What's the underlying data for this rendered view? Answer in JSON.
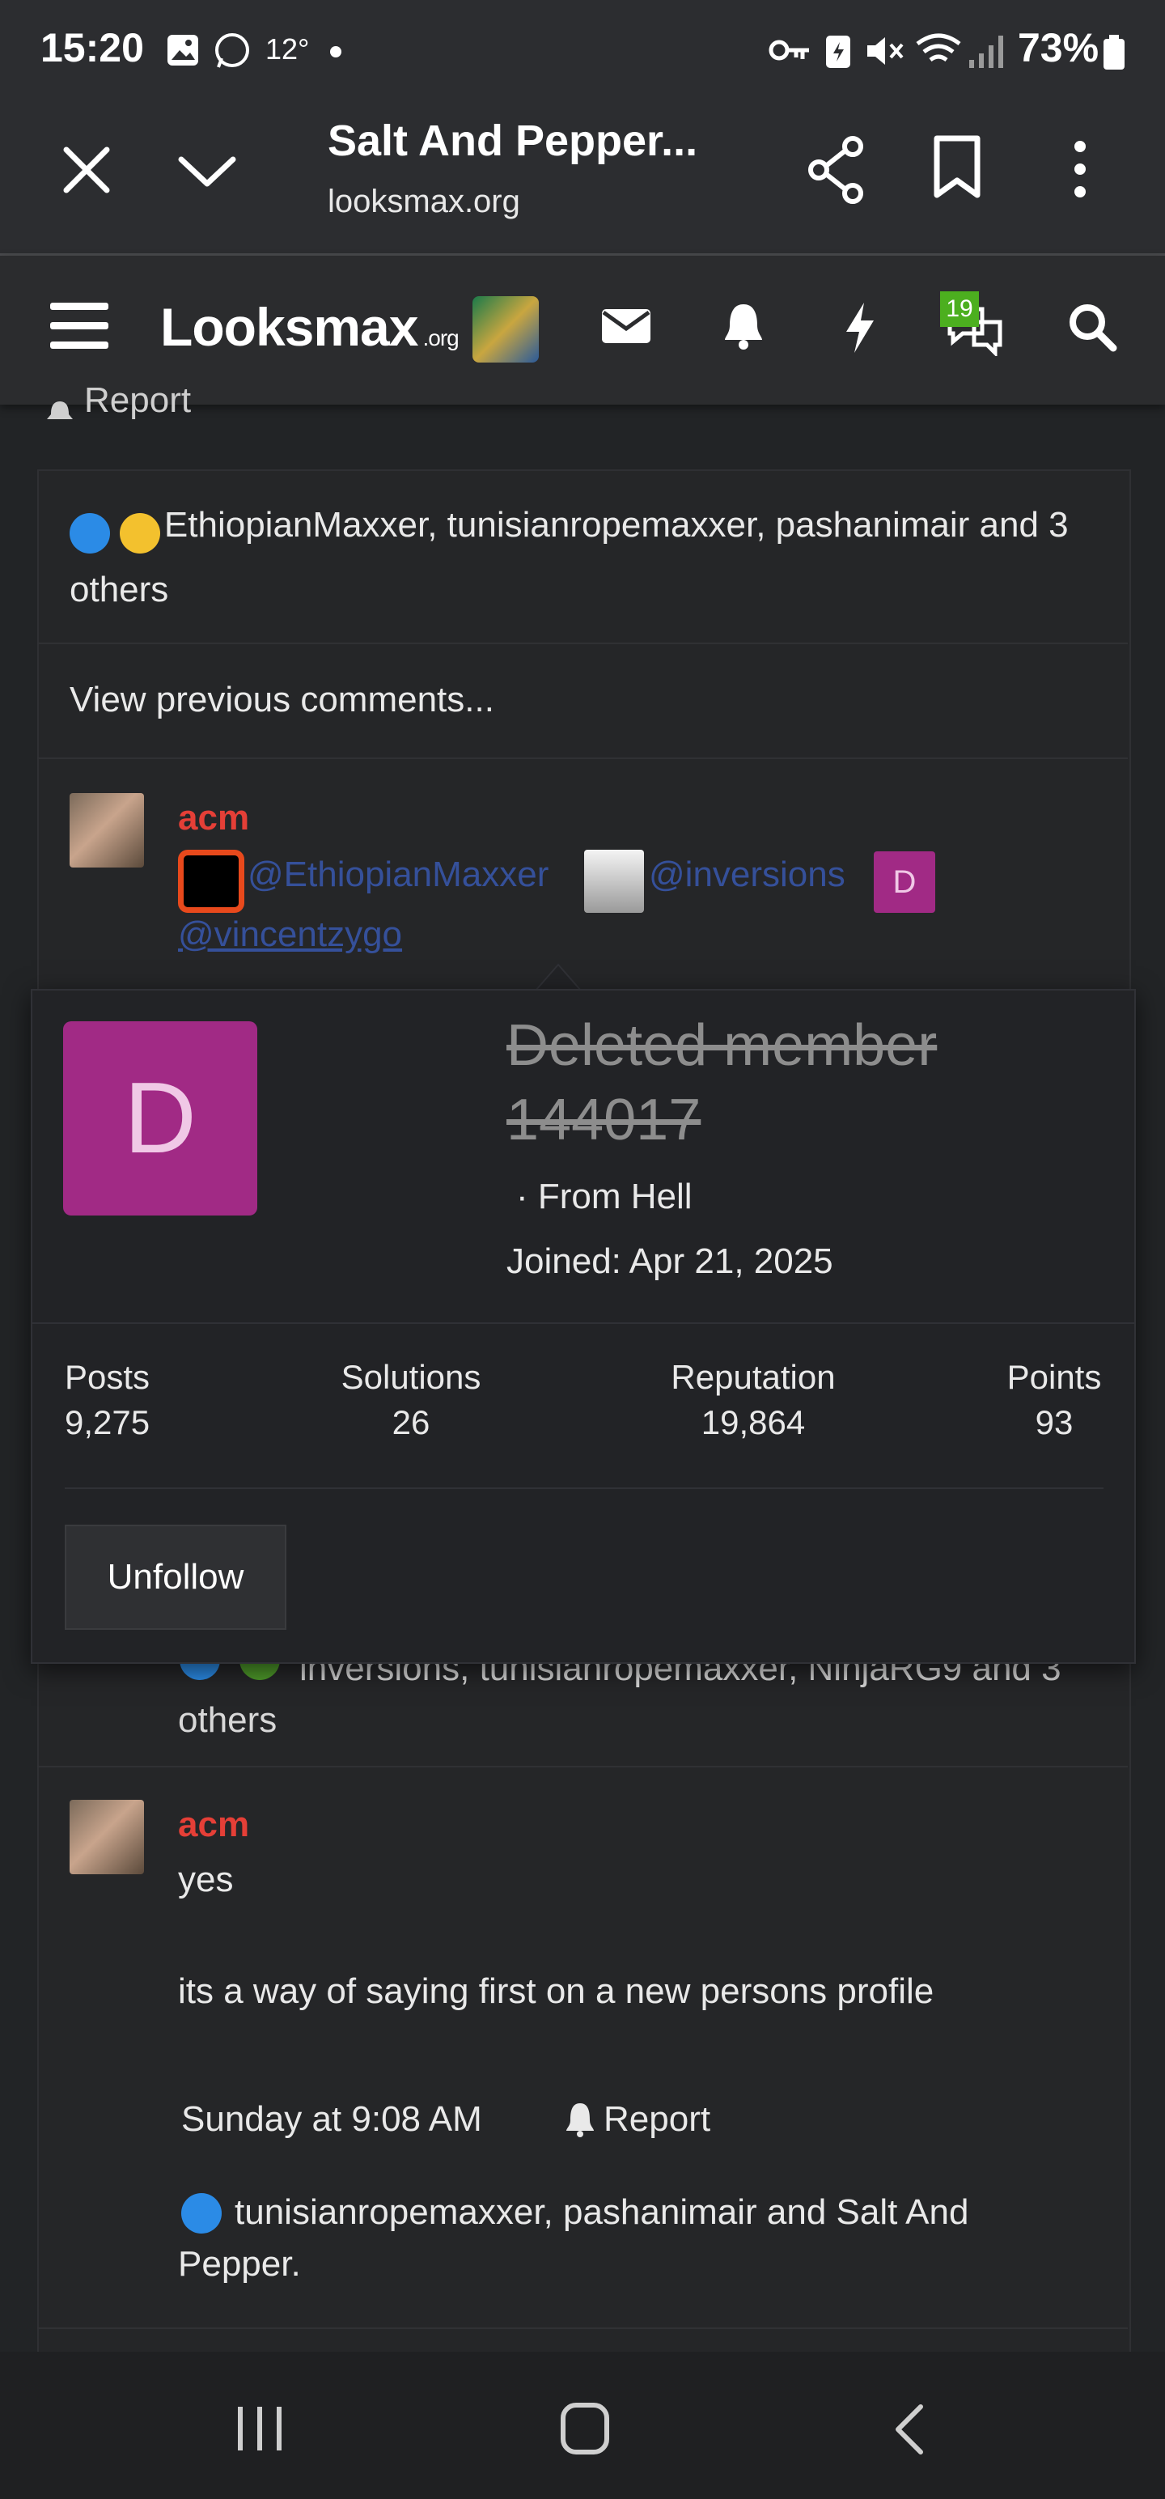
{
  "status_bar": {
    "time": "15:20",
    "temperature": "12°",
    "battery": "73%"
  },
  "browser": {
    "page_title": "Salt And Pepper...",
    "url": "looksmax.org"
  },
  "site": {
    "logo": "Looksmax",
    "logo_suffix": ".org",
    "messages_badge": "19"
  },
  "peek_text": "Report",
  "top_reactions": {
    "text": "EthiopianMaxxer, tunisianropemaxxer, pashanimair and 3 others"
  },
  "view_previous": "View previous comments...",
  "comment1": {
    "author": "acm",
    "mentions": [
      "@EthiopianMaxxer",
      "@inversions",
      "@vincentzygo"
    ],
    "avatar_letter": "D",
    "reactions_text": "inversions, tunisianropemaxxer, NinjaRG9 and 3 others"
  },
  "popup": {
    "avatar_letter": "D",
    "name": "Deleted member 144017",
    "location": "· From Hell",
    "joined": "Joined: Apr 21, 2025",
    "stats": [
      {
        "label": "Posts",
        "value": "9,275"
      },
      {
        "label": "Solutions",
        "value": "26"
      },
      {
        "label": "Reputation",
        "value": "19,864"
      },
      {
        "label": "Points",
        "value": "93"
      }
    ],
    "unfollow": "Unfollow"
  },
  "comment2": {
    "author": "acm",
    "line1": "yes",
    "line2": "its a way of saying first on a new persons profile",
    "timestamp": "Sunday at 9:08 AM",
    "report": "Report",
    "reactions_text": "tunisianropemaxxer, pashanimair and Salt And Pepper."
  },
  "icons": [
    "close-icon",
    "chevron-down-icon",
    "share-icon",
    "bookmark-icon",
    "more-icon",
    "menu-icon",
    "mail-icon",
    "bell-icon",
    "bolt-icon",
    "chat-icon",
    "search-icon",
    "recent-apps-icon",
    "home-icon",
    "back-icon"
  ]
}
